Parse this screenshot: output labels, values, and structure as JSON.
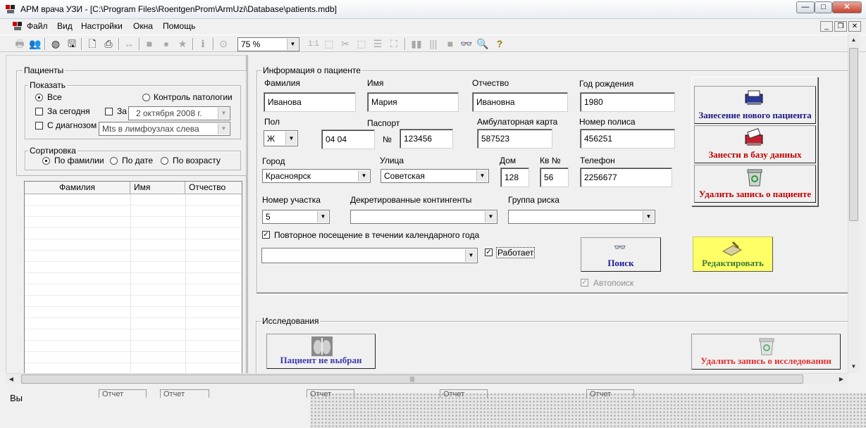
{
  "window": {
    "title": "АРМ врача УЗИ - [C:\\Program Files\\RoentgenProm\\ArmUzi\\Database\\patients.mdb]",
    "min": "—",
    "max": "□",
    "close": "✕"
  },
  "menu": [
    "Файл",
    "Вид",
    "Настройки",
    "Окна",
    "Помощь"
  ],
  "mdi": {
    "min": "_",
    "restore": "❐",
    "close": "✕"
  },
  "toolbar": {
    "zoom": "75 %",
    "zoom_arrow": "▼",
    "icons": {
      "print": "🖶",
      "users": "👥",
      "globe": "◍",
      "save": "🖫",
      "preview": "🗋",
      "printer": "⎙",
      "fit": "↔",
      "square": "■",
      "circle": "●",
      "star": "★",
      "info": "ℹ",
      "timer": "⊙",
      "one_to_one": "1:1",
      "sel": "⬚",
      "cut": "✂",
      "crop": "⬚",
      "list": "☰",
      "frame": "⛶",
      "bars": "▮▮",
      "barcode": "|||",
      "stop": "■",
      "binoc": "👓",
      "zoomin": "🔍",
      "help": "?"
    }
  },
  "patients_panel": {
    "group_title": "Пациенты",
    "show": {
      "title": "Показать",
      "all": "Все",
      "pathology": "Контроль патологии",
      "today": "За сегодня",
      "za": "За",
      "date": "2  октября  2008 г.",
      "diagnosis": "С диагнозом",
      "diagnosis_value": "Mts в  лимфоузлах слева"
    },
    "sort": {
      "title": "Сортировка",
      "by_name": "По фамилии",
      "by_date": "По дате",
      "by_age": "По возрасту"
    },
    "grid": {
      "columns": [
        "Фамилия",
        "Имя",
        "Отчество"
      ]
    }
  },
  "patient_info": {
    "title": "Информация о пациенте",
    "surname_label": "Фамилия",
    "surname": "Иванова",
    "name_label": "Имя",
    "name": "Мария",
    "patronymic_label": "Отчество",
    "patronymic": "Ивановна",
    "birth_label": "Год рождения",
    "birth": "1980",
    "sex_label": "Пол",
    "sex": "Ж",
    "passport_label": "Паспорт",
    "passport_series": "04 04",
    "passport_no_label": "№",
    "passport_no": "123456",
    "card_label": "Амбулаторная карта",
    "card": "587523",
    "policy_label": "Номер полиса",
    "policy": "456251",
    "city_label": "Город",
    "city": "Красноярск",
    "street_label": "Улица",
    "street": "Советская",
    "house_label": "Дом",
    "house": "128",
    "apt_label": "Кв №",
    "apt": "56",
    "phone_label": "Телефон",
    "phone": "2256677",
    "district_label": "Номер участка",
    "district": "5",
    "contingent_label": "Декретированные контингенты",
    "contingent": "",
    "risk_label": "Группа риска",
    "risk": "",
    "repeat_visit": "Повторное посещение в течении календарного года",
    "works": "Работает",
    "search": "Поиск",
    "autosearch": "Автопоиск",
    "edit": "Редактировать",
    "new_patient": "Занесение нового пациента",
    "save_db": "Занести в базу данных",
    "delete_patient": "Удалить запись о пациенте"
  },
  "studies": {
    "title": "Исследования",
    "no_patient": "Пациент не выбран",
    "delete_study": "Удалить запись о исследовании"
  },
  "status": {
    "left": "Вы",
    "p1": "Отчет",
    "p2": "Отчет",
    "p3": "Отчет",
    "p4": "Отчет",
    "p5": "Отчет"
  },
  "colors": {
    "title_blue": "#000080",
    "red_caption": "#d00000",
    "edit_bg": "#ffff66",
    "link_blue": "#1a1aa0"
  }
}
